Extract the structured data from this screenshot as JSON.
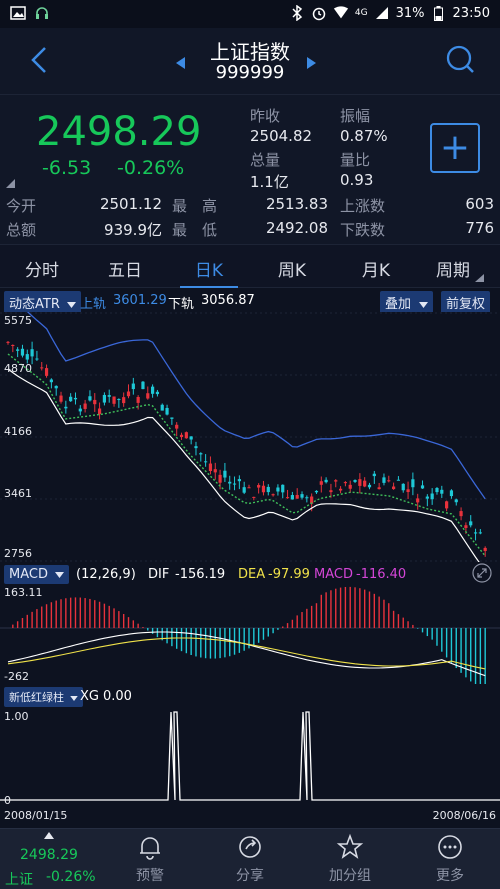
{
  "status_bar": {
    "battery": "31%",
    "time": "23:50",
    "network": "4G"
  },
  "header": {
    "stock_name": "上证指数",
    "stock_code": "999999"
  },
  "quote": {
    "price": "2498.29",
    "change": "-6.53",
    "change_pct": "-0.26%",
    "prev_close_label": "昨收",
    "prev_close": "2504.82",
    "amplitude_label": "振幅",
    "amplitude": "0.87%",
    "volume_label": "总量",
    "volume": "1.1亿",
    "volume_ratio_label": "量比",
    "volume_ratio": "0.93",
    "open_label": "今开",
    "open": "2501.12",
    "high_label": "最　高",
    "high": "2513.83",
    "up_count_label": "上涨数",
    "up_count": "603",
    "amount_label": "总额",
    "amount": "939.9亿",
    "low_label": "最　低",
    "low": "2492.08",
    "down_count_label": "下跌数",
    "down_count": "776",
    "add_label": "+"
  },
  "tabs": [
    {
      "label": "分时"
    },
    {
      "label": "五日"
    },
    {
      "label": "日K"
    },
    {
      "label": "周K"
    },
    {
      "label": "月K"
    },
    {
      "label": "周期"
    }
  ],
  "active_tab": "日K",
  "indicator_bar": {
    "indicator": "动态ATR",
    "upper_label": "上轨",
    "upper_value": "3601.29",
    "lower_label": "下轨",
    "lower_value": "3056.87",
    "overlay_label": "叠加",
    "adjust_label": "前复权"
  },
  "macd_bar": {
    "indicator": "MACD",
    "params": "(12,26,9)",
    "dif_label": "DIF",
    "dif_value": "-156.19",
    "dea_label": "DEA",
    "dea_value": "-97.99",
    "macd_label": "MACD",
    "macd_value": "-116.40"
  },
  "xg_bar": {
    "indicator": "新低红绿柱",
    "xg_label": "XG",
    "xg_value": "0.00"
  },
  "dates": {
    "start": "2008/01/15",
    "end": "2008/06/16"
  },
  "colors": {
    "up": "#e8323c",
    "down": "#1ec8d6",
    "accent": "#3d8be4",
    "green": "#17c85a"
  },
  "chart_data": [
    {
      "type": "candlestick",
      "title": "动态ATR",
      "y_ticks": [
        "5575",
        "4870",
        "4166",
        "3461",
        "2756"
      ],
      "ylim": [
        2756,
        5575
      ],
      "x_range": [
        "2008/01/15",
        "2008/06/16"
      ],
      "series": [
        {
          "name": "上轨",
          "last": 3601.29
        },
        {
          "name": "下轨",
          "last": 3056.87
        }
      ]
    },
    {
      "type": "bar",
      "title": "MACD",
      "y_ticks": [
        "163.11",
        "-262"
      ],
      "ylim": [
        -262,
        163.11
      ],
      "series": [
        {
          "name": "DIF",
          "last": -156.19
        },
        {
          "name": "DEA",
          "last": -97.99
        },
        {
          "name": "MACD",
          "last": -116.4
        }
      ]
    },
    {
      "type": "line",
      "title": "新低红绿柱",
      "y_ticks": [
        "1.00",
        "0"
      ],
      "ylim": [
        0,
        1
      ],
      "series": [
        {
          "name": "XG",
          "last": 0.0
        }
      ]
    }
  ],
  "bottom_nav": {
    "index_price": "2498.29",
    "index_name": "上证",
    "index_change": "-0.26%",
    "items": [
      {
        "label": "预警",
        "icon": "bell-icon"
      },
      {
        "label": "分享",
        "icon": "share-icon"
      },
      {
        "label": "加分组",
        "icon": "star-icon"
      },
      {
        "label": "更多",
        "icon": "more-icon"
      }
    ]
  }
}
